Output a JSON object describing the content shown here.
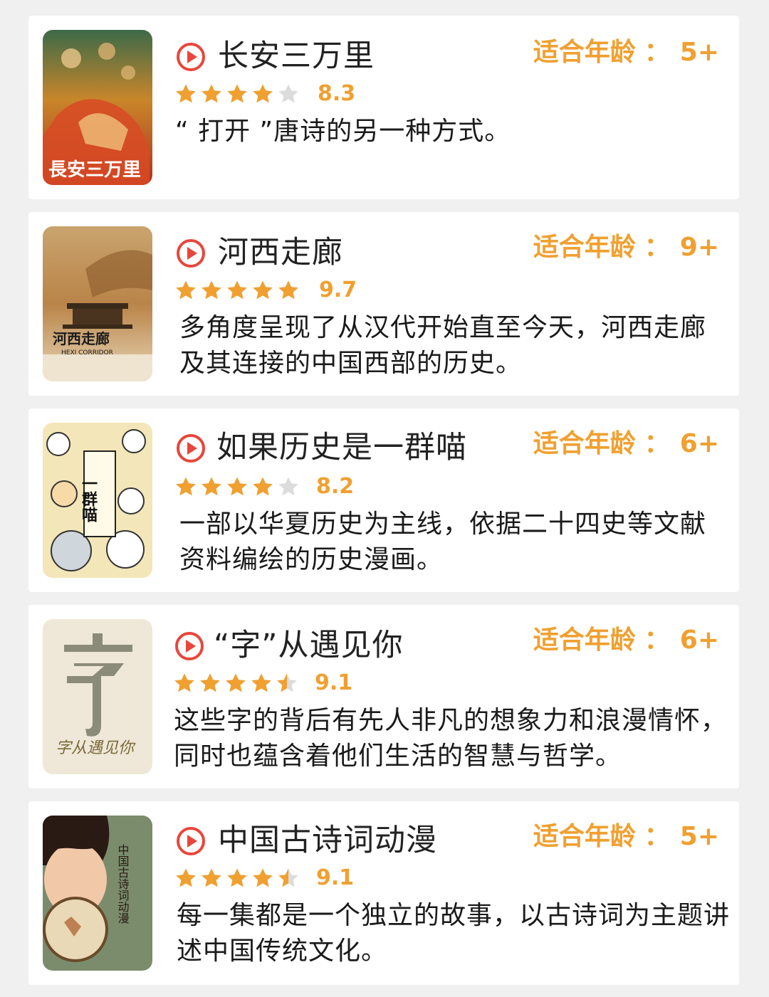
{
  "age_label": "适合年龄",
  "age_separator": "：",
  "accent_color": "#f0a030",
  "play_icon_color": "#e8463c",
  "items": [
    {
      "title": "长安三万里",
      "age": "5+",
      "rating": "8.3",
      "stars": 4,
      "description": "“ 打开 ”唐诗的另一种方式。",
      "poster_text": "長安三万里",
      "poster_icon": "movie-poster-changan"
    },
    {
      "title": "河西走廊",
      "age": "9+",
      "rating": "9.7",
      "stars": 5,
      "description": "多角度呈现了从汉代开始直至今天，河西走廊及其连接的中国西部的历史。",
      "poster_text": "河西走廊",
      "poster_subtext": "HEXI CORRIDOR",
      "poster_icon": "documentary-poster-hexi"
    },
    {
      "title": "如果历史是一群喵",
      "age": "6+",
      "rating": "8.2",
      "stars": 4,
      "description": "一部以华夏历史为主线，依据二十四史等文献资料编绘的历史漫画。",
      "poster_text": "一群喵",
      "poster_icon": "cartoon-poster-cats"
    },
    {
      "title": "“字”从遇见你",
      "age": "6+",
      "rating": "9.1",
      "stars": 4.5,
      "description": "这些字的背后有先人非凡的想象力和浪漫情怀，同时也蕴含着他们生活的智慧与哲学。",
      "poster_text": "字从遇见你",
      "poster_icon": "poster-character-zi"
    },
    {
      "title": "中国古诗词动漫",
      "age": "5+",
      "rating": "9.1",
      "stars": 4.5,
      "description": "每一集都是一个独立的故事，以古诗词为主题讲述中国传统文化。",
      "poster_text": "中国古诗词动漫",
      "poster_icon": "anime-poster-poetry"
    }
  ]
}
